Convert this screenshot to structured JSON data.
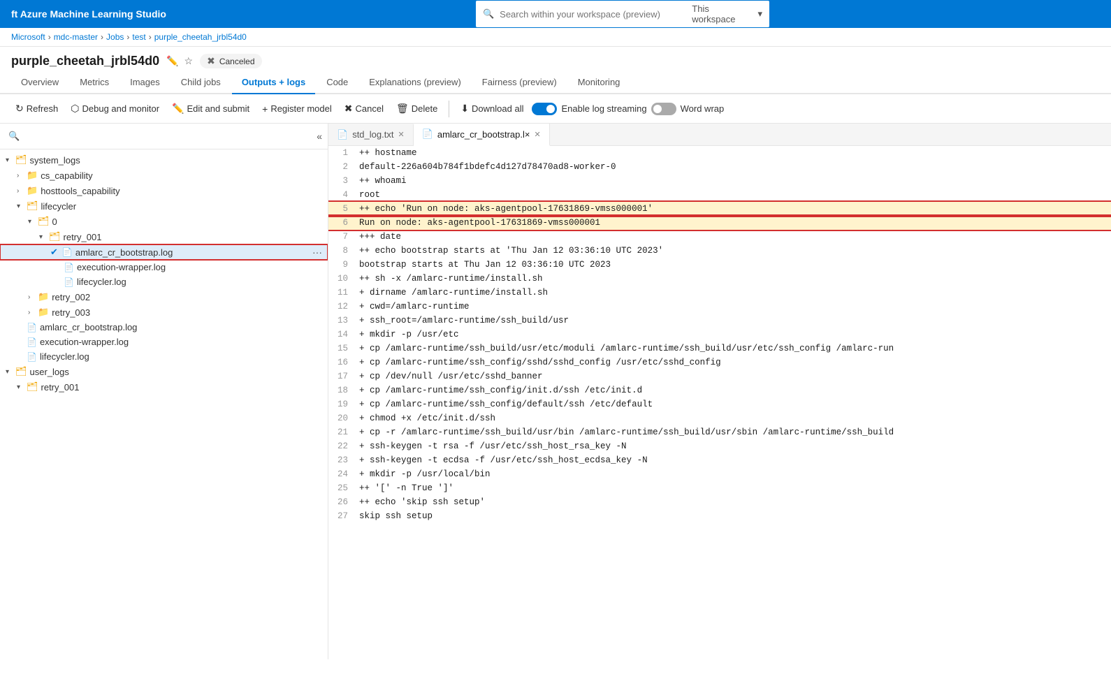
{
  "app": {
    "title": "ft Azure Machine Learning Studio"
  },
  "search": {
    "placeholder": "Search within your workspace (preview)",
    "workspace_label": "This workspace"
  },
  "breadcrumb": {
    "items": [
      "Microsoft",
      "mdc-master",
      "Jobs",
      "test",
      "purple_cheetah_jrbl54d0"
    ]
  },
  "page": {
    "title": "purple_cheetah_jrbl54d0",
    "status": "Canceled"
  },
  "tabs": [
    {
      "label": "Overview",
      "active": false
    },
    {
      "label": "Metrics",
      "active": false
    },
    {
      "label": "Images",
      "active": false
    },
    {
      "label": "Child jobs",
      "active": false
    },
    {
      "label": "Outputs + logs",
      "active": true
    },
    {
      "label": "Code",
      "active": false
    },
    {
      "label": "Explanations (preview)",
      "active": false
    },
    {
      "label": "Fairness (preview)",
      "active": false
    },
    {
      "label": "Monitoring",
      "active": false
    }
  ],
  "toolbar": {
    "refresh_label": "Refresh",
    "debug_label": "Debug and monitor",
    "edit_label": "Edit and submit",
    "register_label": "Register model",
    "cancel_label": "Cancel",
    "delete_label": "Delete",
    "download_label": "Download all",
    "log_streaming_label": "Enable log streaming",
    "word_wrap_label": "Word wrap"
  },
  "file_tree": {
    "items": [
      {
        "id": "system_logs",
        "label": "system_logs",
        "type": "folder",
        "level": 0,
        "expanded": true,
        "arrow": "▾"
      },
      {
        "id": "cs_capability",
        "label": "cs_capability",
        "type": "folder",
        "level": 1,
        "expanded": false,
        "arrow": "›"
      },
      {
        "id": "hosttools_capability",
        "label": "hosttools_capability",
        "type": "folder",
        "level": 1,
        "expanded": false,
        "arrow": "›"
      },
      {
        "id": "lifecycler",
        "label": "lifecycler",
        "type": "folder",
        "level": 1,
        "expanded": true,
        "arrow": "▾"
      },
      {
        "id": "zero",
        "label": "0",
        "type": "folder",
        "level": 2,
        "expanded": true,
        "arrow": "▾"
      },
      {
        "id": "retry_001",
        "label": "retry_001",
        "type": "folder",
        "level": 3,
        "expanded": true,
        "arrow": "▾"
      },
      {
        "id": "amlarc_cr_bootstrap_log_sel",
        "label": "amlarc_cr_bootstrap.log",
        "type": "file",
        "level": 4,
        "selected": true,
        "highlighted": true
      },
      {
        "id": "execution_wrapper_log",
        "label": "execution-wrapper.log",
        "type": "file",
        "level": 4
      },
      {
        "id": "lifecycler_log",
        "label": "lifecycler.log",
        "type": "file",
        "level": 4
      },
      {
        "id": "retry_002",
        "label": "retry_002",
        "type": "folder",
        "level": 2,
        "expanded": false,
        "arrow": "›"
      },
      {
        "id": "retry_003",
        "label": "retry_003",
        "type": "folder",
        "level": 2,
        "expanded": false,
        "arrow": "›"
      },
      {
        "id": "amlarc_cr_bootstrap_log2",
        "label": "amlarc_cr_bootstrap.log",
        "type": "file",
        "level": 1
      },
      {
        "id": "execution_wrapper_log2",
        "label": "execution-wrapper.log",
        "type": "file",
        "level": 1
      },
      {
        "id": "lifecycler_log2",
        "label": "lifecycler.log",
        "type": "file",
        "level": 1
      },
      {
        "id": "user_logs",
        "label": "user_logs",
        "type": "folder",
        "level": 0,
        "expanded": true,
        "arrow": "▾"
      },
      {
        "id": "retry_001_user",
        "label": "retry_001",
        "type": "folder",
        "level": 1,
        "expanded": true,
        "arrow": "▾"
      }
    ]
  },
  "code_tabs": [
    {
      "label": "std_log.txt",
      "active": false,
      "closable": true
    },
    {
      "label": "amlarc_cr_bootstrap.l×",
      "active": true,
      "closable": true
    }
  ],
  "code_lines": [
    {
      "num": 1,
      "content": "++ hostname",
      "highlighted": false
    },
    {
      "num": 2,
      "content": "default-226a604b784f1bdefc4d127d78470ad8-worker-0",
      "highlighted": false
    },
    {
      "num": 3,
      "content": "++ whoami",
      "highlighted": false
    },
    {
      "num": 4,
      "content": "root",
      "highlighted": false
    },
    {
      "num": 5,
      "content": "++ echo 'Run on node: aks-agentpool-17631869-vmss000001'",
      "highlighted": true
    },
    {
      "num": 6,
      "content": "Run on node: aks-agentpool-17631869-vmss000001",
      "highlighted": true
    },
    {
      "num": 7,
      "content": "+++ date",
      "highlighted": false
    },
    {
      "num": 8,
      "content": "++ echo bootstrap starts at 'Thu Jan 12 03:36:10 UTC 2023'",
      "highlighted": false
    },
    {
      "num": 9,
      "content": "bootstrap starts at Thu Jan 12 03:36:10 UTC 2023",
      "highlighted": false
    },
    {
      "num": 10,
      "content": "++ sh -x /amlarc-runtime/install.sh",
      "highlighted": false
    },
    {
      "num": 11,
      "content": "+ dirname /amlarc-runtime/install.sh",
      "highlighted": false
    },
    {
      "num": 12,
      "content": "+ cwd=/amlarc-runtime",
      "highlighted": false
    },
    {
      "num": 13,
      "content": "+ ssh_root=/amlarc-runtime/ssh_build/usr",
      "highlighted": false
    },
    {
      "num": 14,
      "content": "+ mkdir -p /usr/etc",
      "highlighted": false
    },
    {
      "num": 15,
      "content": "+ cp /amlarc-runtime/ssh_build/usr/etc/moduli /amlarc-runtime/ssh_build/usr/etc/ssh_config /amlarc-run",
      "highlighted": false
    },
    {
      "num": 16,
      "content": "+ cp /amlarc-runtime/ssh_config/sshd/sshd_config /usr/etc/sshd_config",
      "highlighted": false
    },
    {
      "num": 17,
      "content": "+ cp /dev/null /usr/etc/sshd_banner",
      "highlighted": false
    },
    {
      "num": 18,
      "content": "+ cp /amlarc-runtime/ssh_config/init.d/ssh /etc/init.d",
      "highlighted": false
    },
    {
      "num": 19,
      "content": "+ cp /amlarc-runtime/ssh_config/default/ssh /etc/default",
      "highlighted": false
    },
    {
      "num": 20,
      "content": "+ chmod +x /etc/init.d/ssh",
      "highlighted": false
    },
    {
      "num": 21,
      "content": "+ cp -r /amlarc-runtime/ssh_build/usr/bin /amlarc-runtime/ssh_build/usr/sbin /amlarc-runtime/ssh_build",
      "highlighted": false
    },
    {
      "num": 22,
      "content": "+ ssh-keygen -t rsa -f /usr/etc/ssh_host_rsa_key -N",
      "highlighted": false
    },
    {
      "num": 23,
      "content": "+ ssh-keygen -t ecdsa -f /usr/etc/ssh_host_ecdsa_key -N",
      "highlighted": false
    },
    {
      "num": 24,
      "content": "+ mkdir -p /usr/local/bin",
      "highlighted": false
    },
    {
      "num": 25,
      "content": "++ '[' -n True ']'",
      "highlighted": false
    },
    {
      "num": 26,
      "content": "++ echo 'skip ssh setup'",
      "highlighted": false
    },
    {
      "num": 27,
      "content": "skip ssh setup",
      "highlighted": false
    }
  ]
}
